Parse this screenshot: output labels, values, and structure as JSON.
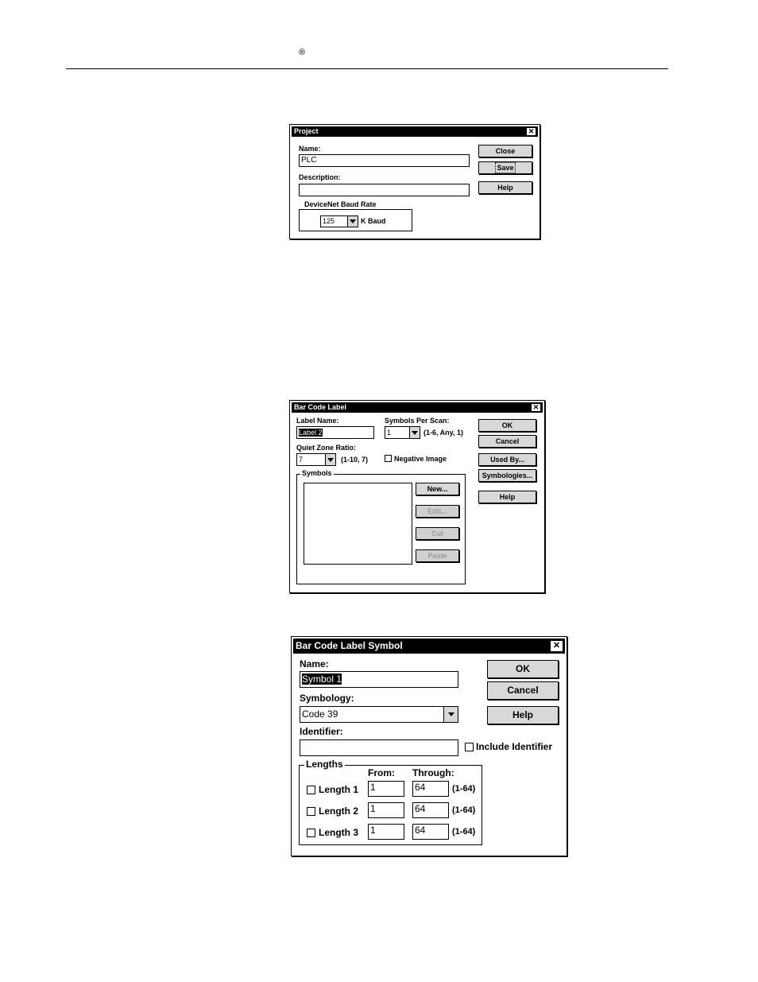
{
  "page": {
    "registered_mark": "®"
  },
  "project": {
    "title": "Project",
    "name_label": "Name:",
    "name_value": "PLC",
    "description_label": "Description:",
    "description_value": "",
    "baud_group": "DeviceNet Baud Rate",
    "baud_value": "125",
    "baud_unit": "K Baud",
    "close_label": "Close",
    "save_label": "Save",
    "help_label": "Help"
  },
  "barcode_label": {
    "title": "Bar Code Label",
    "label_name_label": "Label Name:",
    "label_name_value": "Label 2",
    "symbols_per_scan_label": "Symbols Per Scan:",
    "symbols_per_scan_value": "1",
    "symbols_per_scan_hint": "(1-6, Any, 1)",
    "quiet_zone_label": "Quiet Zone Ratio:",
    "quiet_zone_value": "7",
    "quiet_zone_hint": "(1-10, 7)",
    "negative_image_label": "Negative Image",
    "symbols_group": "Symbols",
    "new_label": "New...",
    "edit_label": "Edit...",
    "cut_label": "Cut",
    "paste_label": "Paste",
    "ok_label": "OK",
    "cancel_label": "Cancel",
    "used_by_label": "Used By...",
    "symbologies_label": "Symbologies...",
    "help_label": "Help"
  },
  "barcode_symbol": {
    "title": "Bar Code Label Symbol",
    "name_label": "Name:",
    "name_value": "Symbol 1",
    "symbology_label": "Symbology:",
    "symbology_value": "Code 39",
    "identifier_label": "Identifier:",
    "identifier_value": "",
    "include_identifier_label": "Include Identifier",
    "lengths_group": "Lengths",
    "from_label": "From:",
    "through_label": "Through:",
    "lengths": [
      {
        "label": "Length 1",
        "from": "1",
        "through": "64",
        "range": "(1-64)"
      },
      {
        "label": "Length 2",
        "from": "1",
        "through": "64",
        "range": "(1-64)"
      },
      {
        "label": "Length 3",
        "from": "1",
        "through": "64",
        "range": "(1-64)"
      }
    ],
    "ok_label": "OK",
    "cancel_label": "Cancel",
    "help_label": "Help"
  }
}
